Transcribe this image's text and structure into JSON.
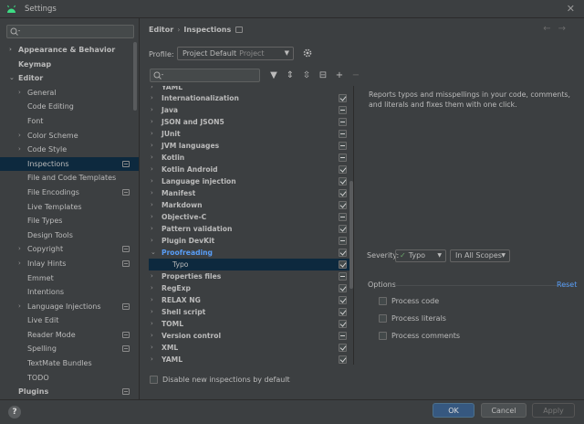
{
  "window": {
    "title": "Settings"
  },
  "nav": {
    "search_placeholder": "",
    "items": [
      {
        "label": "Appearance & Behavior",
        "level": 0,
        "arrow": "›",
        "bold": true
      },
      {
        "label": "Keymap",
        "level": 0,
        "bold": true
      },
      {
        "label": "Editor",
        "level": 0,
        "arrow": "⌄",
        "bold": true
      },
      {
        "label": "General",
        "level": 1,
        "arrow": "›"
      },
      {
        "label": "Code Editing",
        "level": 1
      },
      {
        "label": "Font",
        "level": 1
      },
      {
        "label": "Color Scheme",
        "level": 1,
        "arrow": "›"
      },
      {
        "label": "Code Style",
        "level": 1,
        "arrow": "›"
      },
      {
        "label": "Inspections",
        "level": 1,
        "badge": true,
        "selected": true
      },
      {
        "label": "File and Code Templates",
        "level": 1
      },
      {
        "label": "File Encodings",
        "level": 1,
        "badge": true
      },
      {
        "label": "Live Templates",
        "level": 1
      },
      {
        "label": "File Types",
        "level": 1
      },
      {
        "label": "Design Tools",
        "level": 1
      },
      {
        "label": "Copyright",
        "level": 1,
        "arrow": "›",
        "badge": true
      },
      {
        "label": "Inlay Hints",
        "level": 1,
        "arrow": "›",
        "badge": true
      },
      {
        "label": "Emmet",
        "level": 1
      },
      {
        "label": "Intentions",
        "level": 1
      },
      {
        "label": "Language Injections",
        "level": 1,
        "arrow": "›",
        "badge": true
      },
      {
        "label": "Live Edit",
        "level": 1
      },
      {
        "label": "Reader Mode",
        "level": 1,
        "badge": true
      },
      {
        "label": "Spelling",
        "level": 1,
        "badge": true
      },
      {
        "label": "TextMate Bundles",
        "level": 1
      },
      {
        "label": "TODO",
        "level": 1
      },
      {
        "label": "Plugins",
        "level": 0,
        "bold": true,
        "badge": true
      }
    ]
  },
  "breadcrumb": {
    "parent": "Editor",
    "separator": "›",
    "current": "Inspections"
  },
  "profile": {
    "label": "Profile:",
    "name": "Project Default",
    "scope": "Project"
  },
  "tree": {
    "rows": [
      {
        "label": "YAML",
        "state": "mixed",
        "partial": true
      },
      {
        "label": "Internationalization",
        "state": "checked"
      },
      {
        "label": "Java",
        "state": "mixed"
      },
      {
        "label": "JSON and JSON5",
        "state": "mixed"
      },
      {
        "label": "JUnit",
        "state": "mixed"
      },
      {
        "label": "JVM languages",
        "state": "mixed"
      },
      {
        "label": "Kotlin",
        "state": "mixed"
      },
      {
        "label": "Kotlin Android",
        "state": "checked"
      },
      {
        "label": "Language injection",
        "state": "checked"
      },
      {
        "label": "Manifest",
        "state": "checked"
      },
      {
        "label": "Markdown",
        "state": "checked"
      },
      {
        "label": "Objective-C",
        "state": "mixed"
      },
      {
        "label": "Pattern validation",
        "state": "checked"
      },
      {
        "label": "Plugin DevKit",
        "state": "mixed"
      },
      {
        "label": "Proofreading",
        "state": "checked",
        "expanded": true,
        "blue": true
      },
      {
        "label": "Typo",
        "state": "checked",
        "child": true,
        "selected": true
      },
      {
        "label": "Properties files",
        "state": "mixed"
      },
      {
        "label": "RegExp",
        "state": "checked"
      },
      {
        "label": "RELAX NG",
        "state": "checked"
      },
      {
        "label": "Shell script",
        "state": "checked"
      },
      {
        "label": "TOML",
        "state": "checked"
      },
      {
        "label": "Version control",
        "state": "mixed"
      },
      {
        "label": "XML",
        "state": "checked"
      },
      {
        "label": "YAML",
        "state": "checked"
      }
    ]
  },
  "disable_new": {
    "label": "Disable new inspections by default",
    "checked": false
  },
  "description": "Reports typos and misspellings in your code, comments, and literals and fixes them with one click.",
  "severity": {
    "label": "Severity:",
    "value": "Typo",
    "scope": "In All Scopes"
  },
  "options": {
    "title": "Options",
    "reset": "Reset",
    "items": [
      {
        "label": "Process code",
        "checked": false
      },
      {
        "label": "Process literals",
        "checked": false
      },
      {
        "label": "Process comments",
        "checked": false
      }
    ]
  },
  "buttons": {
    "help": "?",
    "ok": "OK",
    "cancel": "Cancel",
    "apply": "Apply"
  },
  "colors": {
    "selection": "#0d293e",
    "accent": "#589df6",
    "ok_button": "#365880"
  }
}
